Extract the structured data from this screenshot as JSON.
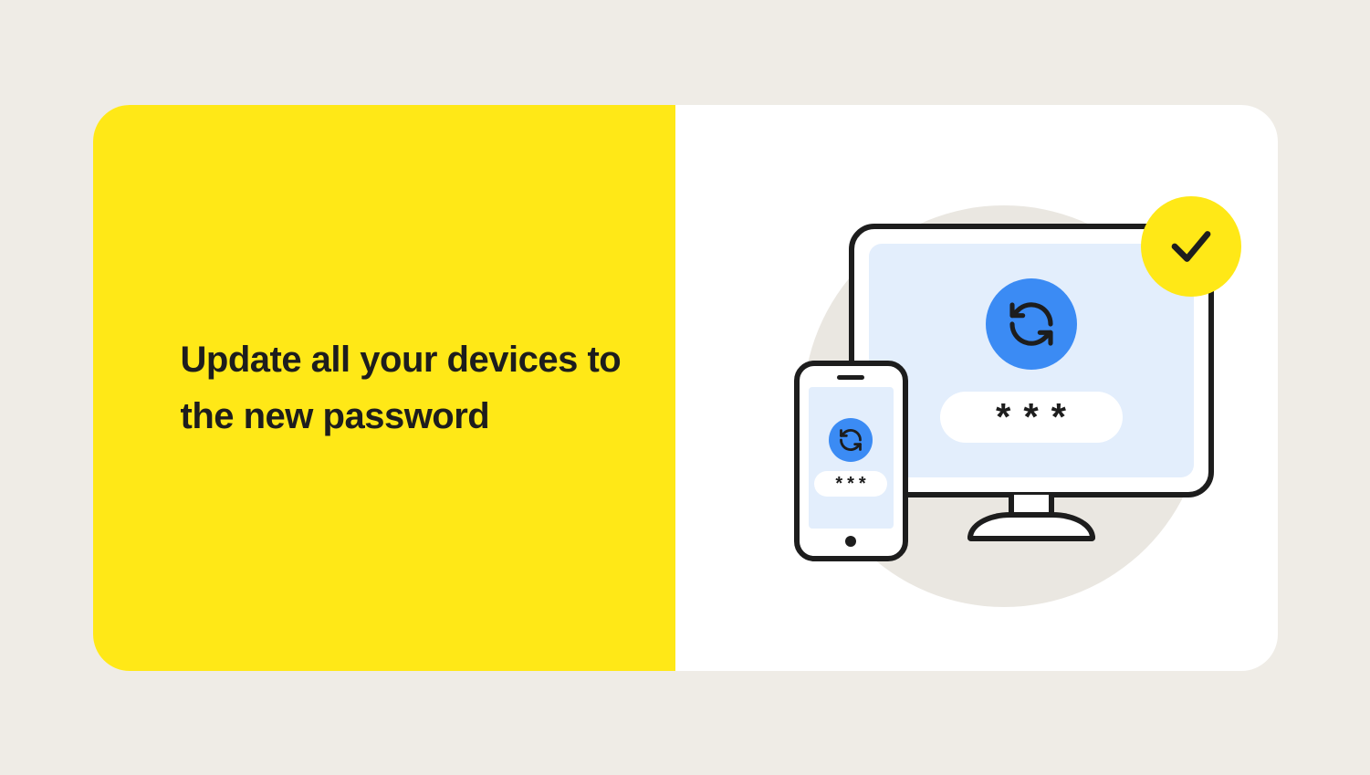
{
  "headline": "Update all your devices to the new password",
  "monitor_password": "***",
  "phone_password": "***",
  "colors": {
    "yellow": "#ffe817",
    "blue": "#3b8bf4",
    "lightblue": "#e3eefc",
    "ink": "#1d1d1d",
    "bg": "#efece6"
  }
}
